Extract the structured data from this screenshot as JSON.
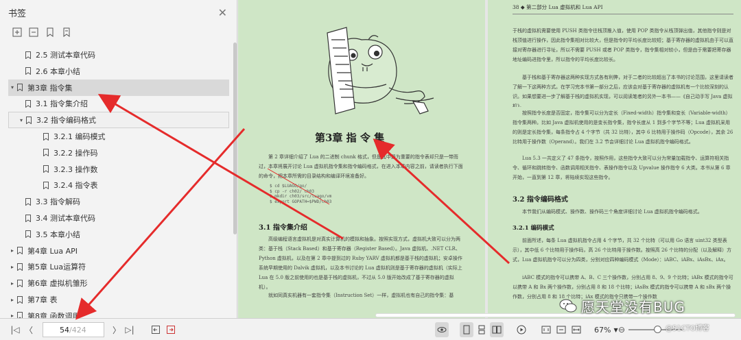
{
  "sidebar": {
    "title": "书签",
    "items": [
      {
        "label": "2.5 测试本章代码",
        "level": 1
      },
      {
        "label": "2.6 本章小结",
        "level": 1
      },
      {
        "label": "第3章 指令集",
        "level": 0
      },
      {
        "label": "3.1 指令集介绍",
        "level": 1
      },
      {
        "label": "3.2 指令编码格式",
        "level": 1
      },
      {
        "label": "3.2.1 编码模式",
        "level": 2
      },
      {
        "label": "3.2.2 操作码",
        "level": 2
      },
      {
        "label": "3.2.3 操作数",
        "level": 2
      },
      {
        "label": "3.2.4 指令表",
        "level": 2
      },
      {
        "label": "3.3 指令解码",
        "level": 1
      },
      {
        "label": "3.4 测试本章代码",
        "level": 1
      },
      {
        "label": "3.5 本章小结",
        "level": 1
      },
      {
        "label": "第4章 Lua API",
        "level": 0
      },
      {
        "label": "第5章 Lua运算符",
        "level": 0
      },
      {
        "label": "第6章 虚拟机雏形",
        "level": 0
      },
      {
        "label": "第7章 表",
        "level": 0
      },
      {
        "label": "第8章 函数调用",
        "level": 0
      }
    ]
  },
  "page_left": {
    "chapter_title": "第3章  指  令  集",
    "intro": "第 2 章详细介绍了 Lua 的二进制 chunk 格式，但是其中最为重要的指令表却只是一带而过，本章将展开讨论 Lua 虚拟机指令集和指令编码格式，在进入本章内容之前，请读者执行下面的命令，把本章所需的目录结构和编译环境准备好。",
    "code": [
      "$ cd $LUAGO/go/",
      "$ cp -r ch02/ ch03",
      "$ mkdir ch03/src/luago/vm",
      "$ export GOPATH=$PWD/ch03"
    ],
    "section_title": "3.1  指令集介绍",
    "section_text": "高级编程语言虚拟机是对真实计算机的模拟和抽象。按照实现方式，虚拟机大致可以分为两类：基于栈（Stack Based）和基于寄存器（Register Based）。Java 虚拟机、.NET CLR、Python 虚拟机，以及在第 2 章中提到过的 Ruby YARV 虚拟机都是基于栈的虚拟机；安卓操作系统早期使用的 Dalvik 虚拟机，以及本书讨论的 Lua 虚拟机则是基于寄存器的虚拟机（实际上 Lua 在 5.0 版之前使用的也是基于栈的虚拟机，不过从 5.0 版开始改成了基于寄存器的虚拟机）。",
    "section_text2": "就如同真实机器有一套指令集（Instruction Set）一样，虚拟机也有自己的指令集：基"
  },
  "page_right": {
    "header": "38    ◆  第二部分  Lua 虚拟机和 Lua API",
    "p1": "于栈的虚拟机需要使用 PUSH 类指令往栈顶推入值，使用 POP 类指令从栈顶弹出值，其他指令则是对栈顶值进行操作，因此指令集相对比较大，但是指令的平均长度比较短；基于寄存器的虚拟机由于可以直接对寄存器进行寻址，所以不需要 PUSH 或者 POP 类指令，指令集相对较小，但是由于需要把寄存器地址编码进指令里，所以指令的平均长度比较长。",
    "p2": "基于栈和基于寄存器这两种实现方式各有利弊，对于二者的比较超出了本书的讨论范围，这里请读者了解一下这两种方式。在学习完本书第一部分之后，应该会对基于寄存器的虚拟机有一个比较深刻的认识。如果想要进一步了解基于栈的虚拟机实现，可以阅读笔者的另外一本书——《自己动手写 Java 虚拟机》。",
    "p3": "按照指令长度是否固定，指令集可以分为定长（Fixed-width）指令集和变长（Variable-width）指令集两种。比如 Java 虚拟机使用的是变长指令集，指令长度从 1 到多个字节不等；Lua 虚拟机采用的则是定长指令集，每条指令占 4 个字节（共 32 比特），其中 6 比特用于操作码（Opcode），其余 26 比特用于操作数（Operand）。我们在 3.2 节会详细讨论 Lua 虚拟机指令编码格式。",
    "p4": "Lua 5.3 一共定义了 47 条指令，按照作用，这些指令大致可以分为常量加载指令、运算符相关指令、循环和跳转指令、函数调用相关指令、表操作指令以及 Upvalue 操作指令 6 大类。本书从第 6 章开始，一直到第 12 章，将陆续实现这些指令。",
    "s32": "3.2  指令编码格式",
    "s32_text": "本节我们从编码模式、操作数、操作码三个角度详细讨论 Lua 虚拟机指令编码格式。",
    "s321": "3.2.1  编码模式",
    "p5": "前面所述，每条 Lua 虚拟机指令占用 4 个字节，共 32 个比特（可以用 Go 语言 uint32 类型表示），其中低 6 个比特用于操作码，高 26 个比特用于操作数。按照高 26 个比特的分配（以及解释）方式，Lua 虚拟机指令可以分为四类，分别对应四种编码模式（Mode）：iABC、iABx、iAsBx、iAx。",
    "p6": "iABC 模式的指令可以携带 A、B、C 三个操作数，分别占用 8、9、9 个比特；iABx 模式的指令可以携带 A 和 Bx 两个操作数，分别占用 8 和 18 个比特；iAsBx 模式的指令可以携带 A 和 sBx 两个操作数，分别占用 8 和 18 个比特；iAx 模式的指令只携带一个操作数"
  },
  "watermark": {
    "text": "愿天堂没有BUG",
    "sub": "@51CTO博客"
  },
  "bottombar": {
    "current_page": "54",
    "total_pages": "/424",
    "zoom": "67%"
  },
  "colors": {
    "page_bg": "#cfe6c6",
    "arrow": "#e52b2b",
    "sidebar_bg": "#f3f3f3"
  }
}
